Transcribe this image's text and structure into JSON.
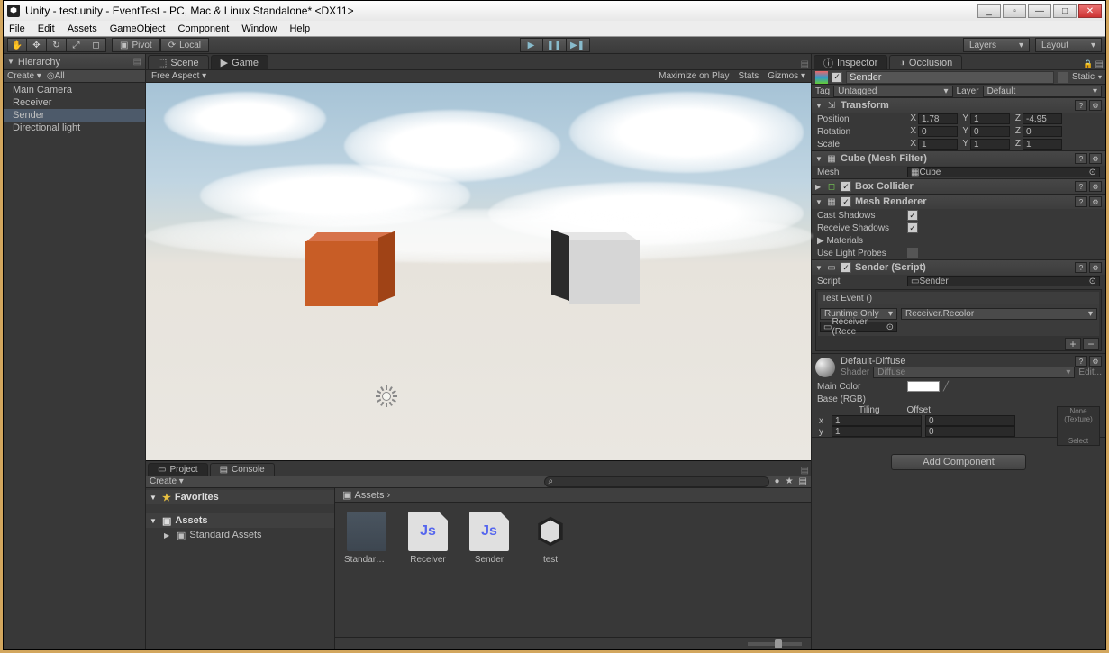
{
  "window": {
    "title": "Unity - test.unity - EventTest - PC, Mac & Linux Standalone* <DX11>"
  },
  "menubar": [
    "File",
    "Edit",
    "Assets",
    "GameObject",
    "Component",
    "Window",
    "Help"
  ],
  "toolbar": {
    "pivot": "Pivot",
    "local": "Local",
    "layers": "Layers",
    "layout": "Layout"
  },
  "hierarchy": {
    "title": "Hierarchy",
    "create": "Create",
    "all": "All",
    "items": [
      "Main Camera",
      "Receiver",
      "Sender",
      "Directional light"
    ],
    "selected": 2
  },
  "sceneTabs": {
    "scene": "Scene",
    "game": "Game"
  },
  "gameBar": {
    "aspect": "Free Aspect",
    "maximize": "Maximize on Play",
    "stats": "Stats",
    "gizmos": "Gizmos"
  },
  "project": {
    "tab": "Project",
    "console": "Console",
    "create": "Create",
    "favorites": "Favorites",
    "assetsRoot": "Assets",
    "standardAssets": "Standard Assets",
    "breadcrumb": "Assets ›",
    "items": [
      {
        "name": "Standard A..",
        "type": "folder"
      },
      {
        "name": "Receiver",
        "type": "js"
      },
      {
        "name": "Sender",
        "type": "js"
      },
      {
        "name": "test",
        "type": "scene"
      }
    ]
  },
  "inspector": {
    "tab": "Inspector",
    "occlusion": "Occlusion",
    "objectName": "Sender",
    "static": "Static",
    "tag": "Tag",
    "tagValue": "Untagged",
    "layer": "Layer",
    "layerValue": "Default",
    "transform": {
      "title": "Transform",
      "position": "Position",
      "px": "1.78",
      "py": "1",
      "pz": "-4.95",
      "rotation": "Rotation",
      "rx": "0",
      "ry": "0",
      "rz": "0",
      "scale": "Scale",
      "sx": "1",
      "sy": "1",
      "sz": "1"
    },
    "meshFilter": {
      "title": "Cube (Mesh Filter)",
      "mesh": "Mesh",
      "value": "Cube"
    },
    "boxCollider": {
      "title": "Box Collider"
    },
    "meshRenderer": {
      "title": "Mesh Renderer",
      "castShadows": "Cast Shadows",
      "receiveShadows": "Receive Shadows",
      "materials": "Materials",
      "useLightProbes": "Use Light Probes"
    },
    "script": {
      "title": "Sender (Script)",
      "scriptLbl": "Script",
      "scriptValue": "Sender",
      "eventTitle": "Test Event ()",
      "runtime": "Runtime Only",
      "callback": "Receiver.Recolor",
      "target": "Receiver (Rece"
    },
    "material": {
      "title": "Default-Diffuse",
      "shaderLbl": "Shader",
      "shaderValue": "Diffuse",
      "edit": "Edit...",
      "mainColor": "Main Color",
      "baseRGB": "Base (RGB)",
      "tiling": "Tiling",
      "offset": "Offset",
      "x": "x",
      "y": "y",
      "xv": "1",
      "yv": "1",
      "ox": "0",
      "oy": "0",
      "noneTex": "None\n(Texture)",
      "select": "Select"
    },
    "addComponent": "Add Component"
  }
}
